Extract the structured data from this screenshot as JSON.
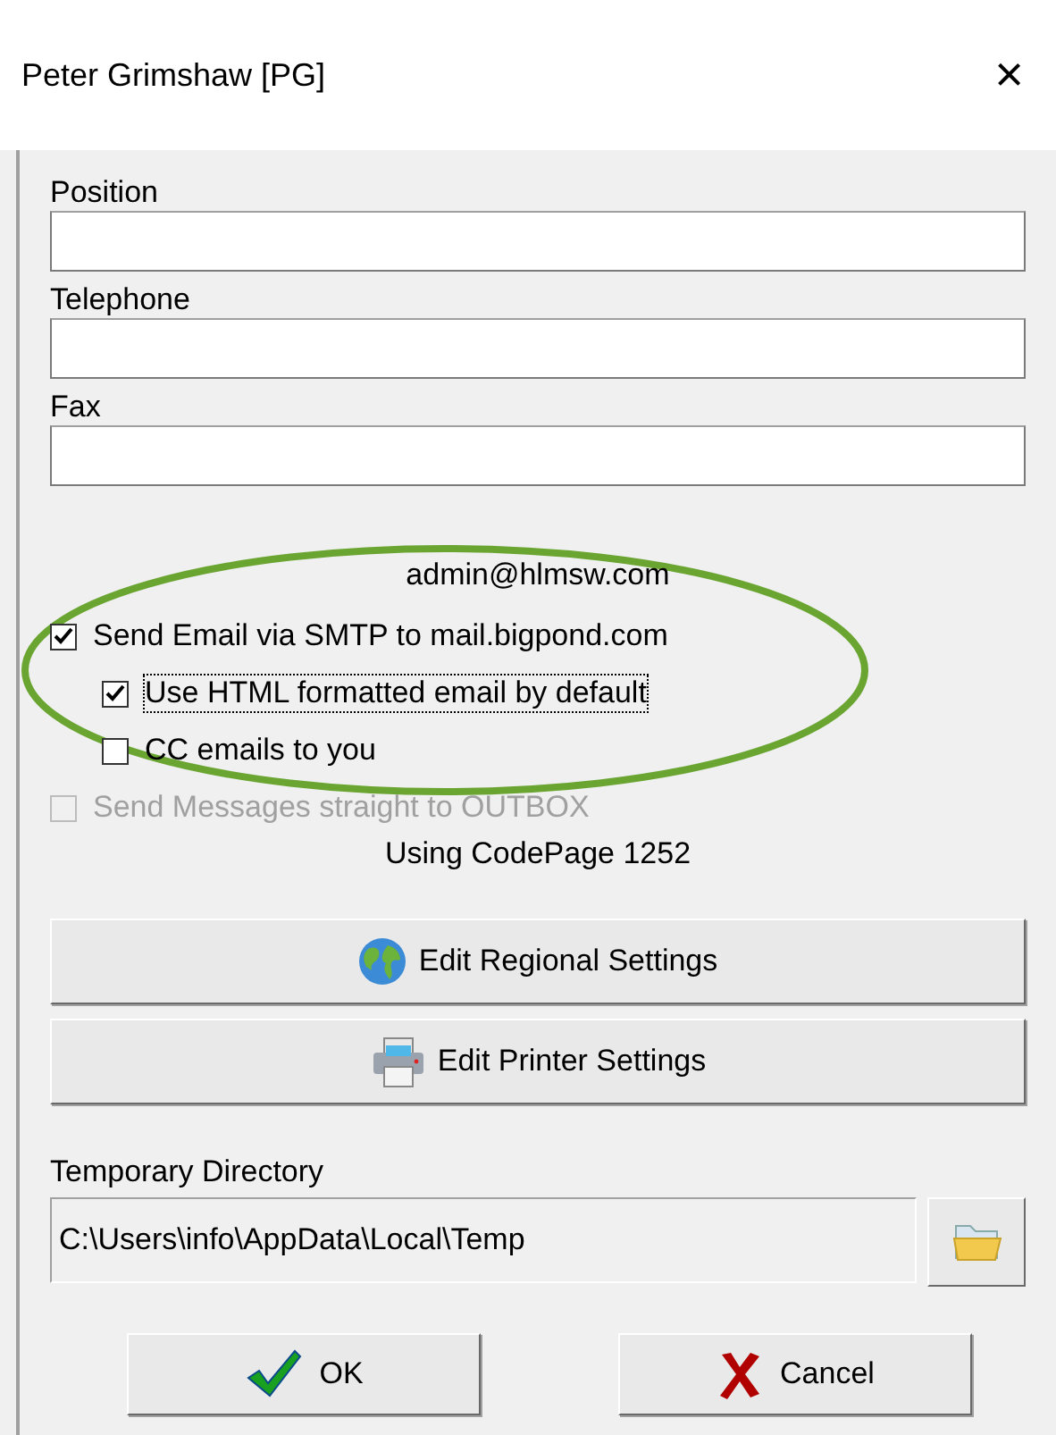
{
  "window": {
    "title": "Peter Grimshaw [PG]",
    "close": "×"
  },
  "fields": [
    {
      "label": "Position"
    },
    {
      "label": "Telephone"
    },
    {
      "label": "Fax"
    }
  ],
  "email_account": "admin@hlmsw.com",
  "options": [
    {
      "label": "Send Email via SMTP to mail.bigpond.com",
      "checked": true,
      "disabled": false,
      "focused": false,
      "children": [
        {
          "label": "Use HTML formatted email by default",
          "checked": true,
          "disabled": false,
          "focused": true
        },
        {
          "label": "CC emails to you",
          "checked": false,
          "disabled": false,
          "focused": false
        }
      ]
    },
    {
      "label": "Send Messages straight to OUTBOX",
      "checked": false,
      "disabled": true,
      "focused": false
    }
  ],
  "codepage": "Using CodePage 1252",
  "setting_buttons": [
    {
      "label": "Edit Regional Settings"
    },
    {
      "label": "Edit Printer Settings"
    }
  ],
  "temp_directory": {
    "label": "Temporary Directory",
    "value": "C:\\Users\\info\\AppData\\Local\\Temp"
  },
  "buttons": [
    {
      "label": "OK"
    },
    {
      "label": "Cancel"
    }
  ]
}
